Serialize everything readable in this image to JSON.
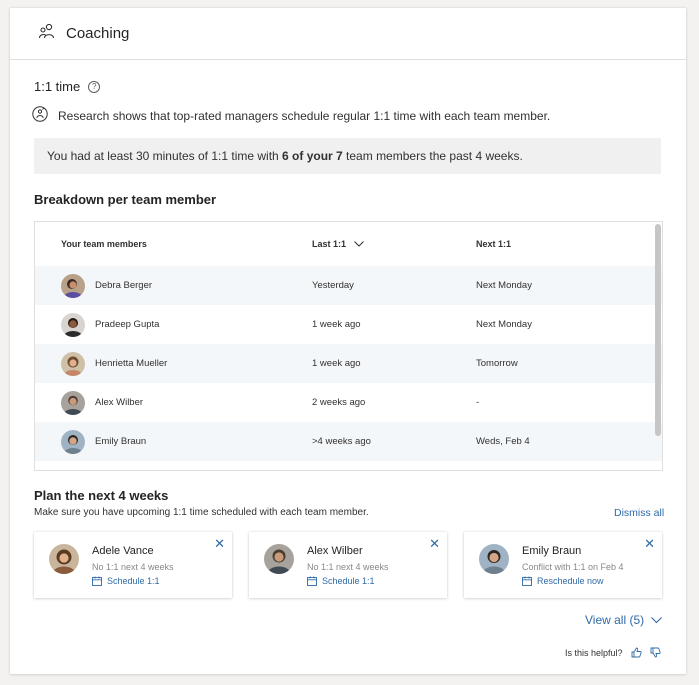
{
  "header": {
    "title": "Coaching"
  },
  "section": {
    "title": "1:1 time",
    "research": "Research shows that top-rated managers schedule regular 1:1 time with each team member.",
    "banner_pre": "You had at least 30 minutes of 1:1 time with ",
    "banner_bold": "6 of your 7",
    "banner_post": " team members the past 4 weeks."
  },
  "breakdown": {
    "title": "Breakdown per team member",
    "columns": {
      "member": "Your team members",
      "last": "Last 1:1",
      "next": "Next 1:1"
    },
    "rows": [
      {
        "name": "Debra Berger",
        "last": "Yesterday",
        "next": "Next Monday"
      },
      {
        "name": "Pradeep Gupta",
        "last": "1 week ago",
        "next": "Next Monday"
      },
      {
        "name": "Henrietta Mueller",
        "last": "1 week ago",
        "next": "Tomorrow"
      },
      {
        "name": "Alex Wilber",
        "last": "2 weeks ago",
        "next": "-"
      },
      {
        "name": "Emily Braun",
        "last": ">4 weeks ago",
        "next": "Weds, Feb 4"
      }
    ]
  },
  "plan": {
    "title": "Plan the next 4 weeks",
    "subtitle": "Make sure you have upcoming 1:1 time scheduled with each team member.",
    "dismiss_all": "Dismiss all",
    "cards": [
      {
        "name": "Adele Vance",
        "note": "No 1:1 next 4 weeks",
        "action": "Schedule 1:1"
      },
      {
        "name": "Alex Wilber",
        "note": "No 1:1 next 4 weeks",
        "action": "Schedule 1:1"
      },
      {
        "name": "Emily Braun",
        "note": "Conflict with 1:1 on Feb 4",
        "action": "Reschedule now"
      }
    ],
    "view_all": "View all (5)"
  },
  "feedback": {
    "prompt": "Is this helpful?"
  },
  "colors": {
    "link": "#2f6aa7",
    "banner_bg": "#f0f0f0",
    "row_alt": "#f4f7fa"
  }
}
